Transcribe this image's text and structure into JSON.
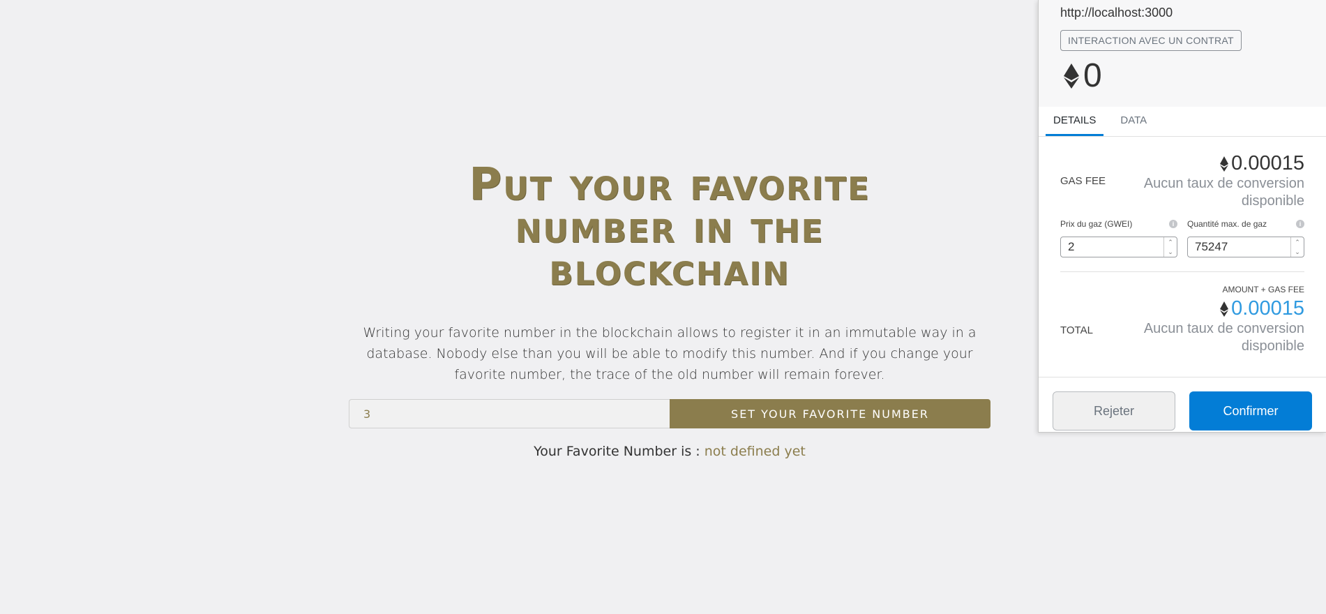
{
  "dapp": {
    "title": "Put your favorite number in the blockchain",
    "intro": "Writing your favorite number in the blockchain allows to register it in an immutable way in a database. Nobody else than you will be able to modify this number. And if you change your favorite number, the trace of the old number will remain forever.",
    "input_value": "3",
    "set_button_label": "SET YOUR FAVORITE NUMBER",
    "favorite_label": "Your Favorite Number is :",
    "favorite_value": "not defined yet",
    "accent_color": "#8b7d4d"
  },
  "metamask": {
    "origin": "http://localhost:3000",
    "badge": "INTERACTION AVEC UN CONTRAT",
    "amount": "0",
    "tabs": [
      {
        "label": "DETAILS",
        "active": true
      },
      {
        "label": "DATA",
        "active": false
      }
    ],
    "gas_fee": {
      "label": "GAS FEE",
      "value": "0.00015",
      "conversion": "Aucun taux de conversion disponible"
    },
    "gas_price": {
      "label": "Prix du gaz (GWEI)",
      "value": "2"
    },
    "gas_limit": {
      "label": "Quantité max. de gaz",
      "value": "75247"
    },
    "total": {
      "header": "AMOUNT + GAS FEE",
      "label": "TOTAL",
      "value": "0.00015",
      "conversion": "Aucun taux de conversion disponible"
    },
    "reject_label": "Rejeter",
    "confirm_label": "Confirmer",
    "primary_color": "#037dd6"
  }
}
